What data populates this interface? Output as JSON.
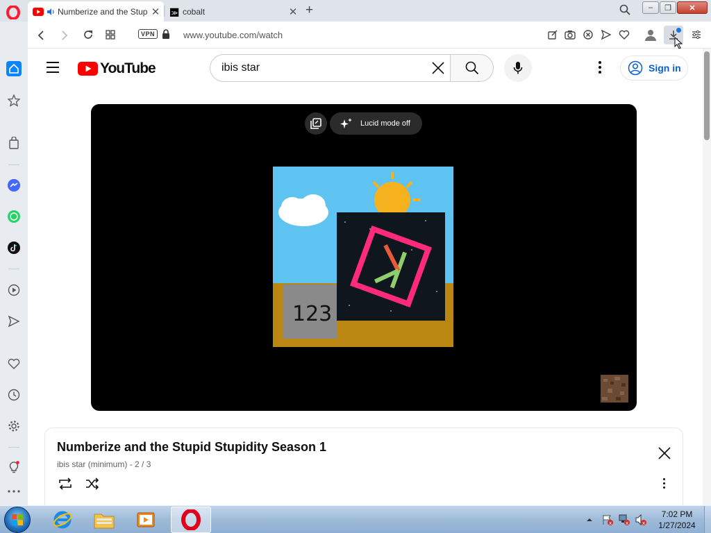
{
  "browser": {
    "tabs": [
      {
        "title": "Numberize and the Stupid Stupidity Season 1",
        "favicon": "youtube-favicon",
        "audio": true,
        "active": true
      },
      {
        "title": "cobalt",
        "favicon": "cobalt-favicon",
        "active": false
      }
    ],
    "new_tab_label": "+",
    "url": "www.youtube.com/watch",
    "vpn_label": "VPN",
    "window_controls": {
      "minimize": "–",
      "maximize": "❐",
      "close": "✕"
    }
  },
  "youtube": {
    "logo_text": "YouTube",
    "search": {
      "value": "ibis star"
    },
    "sign_in_label": "Sign in",
    "player": {
      "lucid_label": "Lucid mode off",
      "frame_label": "123"
    },
    "playlist": {
      "title": "Numberize and the Stupid Stupidity Season 1",
      "owner": "ibis star (minimum)",
      "position": "- 2 / 3"
    }
  },
  "taskbar": {
    "time": "7:02 PM",
    "date": "1/27/2024"
  },
  "colors": {
    "youtube_red": "#ff0000",
    "link_blue": "#065fd4",
    "opera_red": "#ff1b2d",
    "sidebar_active": "#0a84ff"
  }
}
